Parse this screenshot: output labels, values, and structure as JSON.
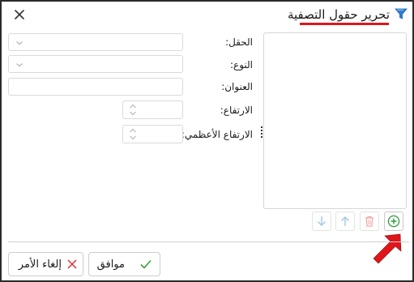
{
  "dialog": {
    "title": "تحرير حقول التصفية",
    "close_symbol": "✕"
  },
  "fields": {
    "field_label": "الحقل:",
    "type_label": "النوع:",
    "caption_label": "العنوان:",
    "height_label": "الارتفاع:",
    "max_height_label": "الارتفاع الأعظمي:",
    "caption_value": "",
    "field_value": "",
    "type_value": ""
  },
  "list_toolbar": {
    "move_down_icon": "arrow-down-icon",
    "move_up_icon": "arrow-up-icon",
    "delete_icon": "trash-icon",
    "add_icon": "plus-circle-icon"
  },
  "footer": {
    "ok_label": "موافق",
    "cancel_label": "إلغاء الأمر"
  },
  "colors": {
    "accent_underline": "#e0151c",
    "add_icon": "#2e9a3c",
    "ok_check": "#3a9f3a",
    "cancel_x": "#d9333a",
    "arrow_callout": "#e0151c",
    "disabled_arrow": "#9fc7e6",
    "disabled_trash": "#f0a7a7"
  }
}
